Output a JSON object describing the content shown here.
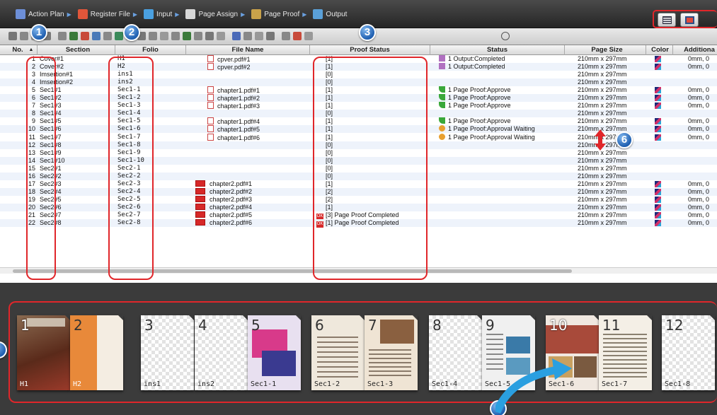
{
  "workflow": {
    "steps": [
      {
        "label": "Action Plan",
        "icon": "action-plan-icon"
      },
      {
        "label": "Register File",
        "icon": "register-file-icon"
      },
      {
        "label": "Input",
        "icon": "input-icon"
      },
      {
        "label": "Page Assign",
        "icon": "page-assign-icon"
      },
      {
        "label": "Page Proof",
        "icon": "page-proof-icon"
      },
      {
        "label": "Output",
        "icon": "output-icon"
      }
    ]
  },
  "view_buttons": [
    {
      "icon": "list-view-icon"
    },
    {
      "icon": "thumbnail-view-icon"
    }
  ],
  "table": {
    "columns": [
      "No.",
      "Section",
      "Folio",
      "File Name",
      "Proof Status",
      "Status",
      "Page Size",
      "Color",
      "Additiona"
    ],
    "sort_indicator": "▲",
    "rows": [
      {
        "no": "1",
        "section": "Cover#1",
        "folio": "H1",
        "file": "cpver.pdf#1",
        "file_icon": "pdf",
        "proof": "[1]",
        "proof_ok": false,
        "status": "1 Output:Completed",
        "status_icon": "output",
        "size": "210mm x 297mm",
        "color": true,
        "additional": "0mm, 0"
      },
      {
        "no": "2",
        "section": "Cover#2",
        "folio": "H2",
        "file": "cpver.pdf#2",
        "file_icon": "pdf",
        "proof": "[1]",
        "proof_ok": false,
        "status": "1 Output:Completed",
        "status_icon": "output",
        "size": "210mm x 297mm",
        "color": true,
        "additional": "0mm, 0"
      },
      {
        "no": "3",
        "section": "Imsertion#1",
        "folio": "ins1",
        "file": "",
        "file_icon": "",
        "proof": "[0]",
        "proof_ok": false,
        "status": "",
        "status_icon": "",
        "size": "210mm x 297mm",
        "color": false,
        "additional": ""
      },
      {
        "no": "4",
        "section": "Imsertion#2",
        "folio": "ins2",
        "file": "",
        "file_icon": "",
        "proof": "[0]",
        "proof_ok": false,
        "status": "",
        "status_icon": "",
        "size": "210mm x 297mm",
        "color": false,
        "additional": ""
      },
      {
        "no": "5",
        "section": "Sec1#1",
        "folio": "Sec1-1",
        "file": "chapter1.pdf#1",
        "file_icon": "pdf",
        "proof": "[1]",
        "proof_ok": false,
        "status": "1 Page Proof:Approve",
        "status_icon": "approve",
        "size": "210mm x 297mm",
        "color": true,
        "additional": "0mm, 0"
      },
      {
        "no": "6",
        "section": "Sec1#2",
        "folio": "Sec1-2",
        "file": "chapter1.pdf#2",
        "file_icon": "pdf",
        "proof": "[1]",
        "proof_ok": false,
        "status": "1 Page Proof:Approve",
        "status_icon": "approve",
        "size": "210mm x 297mm",
        "color": true,
        "additional": "0mm, 0"
      },
      {
        "no": "7",
        "section": "Sec1#3",
        "folio": "Sec1-3",
        "file": "chapter1.pdf#3",
        "file_icon": "pdf",
        "proof": "[1]",
        "proof_ok": false,
        "status": "1 Page Proof:Approve",
        "status_icon": "approve",
        "size": "210mm x 297mm",
        "color": true,
        "additional": "0mm, 0"
      },
      {
        "no": "8",
        "section": "Sec1#4",
        "folio": "Sec1-4",
        "file": "",
        "file_icon": "",
        "proof": "[0]",
        "proof_ok": false,
        "status": "",
        "status_icon": "",
        "size": "210mm x 297mm",
        "color": false,
        "additional": ""
      },
      {
        "no": "9",
        "section": "Sec1#5",
        "folio": "Sec1-5",
        "file": "chapter1.pdf#4",
        "file_icon": "pdf",
        "proof": "[1]",
        "proof_ok": false,
        "status": "1 Page Proof:Approve",
        "status_icon": "approve",
        "size": "210mm x 297mm",
        "color": true,
        "additional": "0mm, 0"
      },
      {
        "no": "10",
        "section": "Sec1#6",
        "folio": "Sec1-6",
        "file": "chapter1.pdf#5",
        "file_icon": "pdf",
        "proof": "[1]",
        "proof_ok": false,
        "status": "1 Page Proof:Approval Waiting",
        "status_icon": "waiting",
        "size": "210mm x 297mm",
        "color": true,
        "additional": "0mm, 0"
      },
      {
        "no": "11",
        "section": "Sec1#7",
        "folio": "Sec1-7",
        "file": "chapter1.pdf#6",
        "file_icon": "pdf",
        "proof": "[1]",
        "proof_ok": false,
        "status": "1 Page Proof:Approval Waiting",
        "status_icon": "waiting",
        "size": "210mm x 297mm",
        "color": true,
        "additional": "0mm, 0"
      },
      {
        "no": "12",
        "section": "Sec1#8",
        "folio": "Sec1-8",
        "file": "",
        "file_icon": "",
        "proof": "[0]",
        "proof_ok": false,
        "status": "",
        "status_icon": "",
        "size": "210mm x 297mm",
        "color": false,
        "additional": ""
      },
      {
        "no": "13",
        "section": "Sec1#9",
        "folio": "Sec1-9",
        "file": "",
        "file_icon": "",
        "proof": "[0]",
        "proof_ok": false,
        "status": "",
        "status_icon": "",
        "size": "210mm x 297mm",
        "color": false,
        "additional": ""
      },
      {
        "no": "14",
        "section": "Sec1#10",
        "folio": "Sec1-10",
        "file": "",
        "file_icon": "",
        "proof": "[0]",
        "proof_ok": false,
        "status": "",
        "status_icon": "",
        "size": "210mm x 297mm",
        "color": false,
        "additional": ""
      },
      {
        "no": "15",
        "section": "Sec2#1",
        "folio": "Sec2-1",
        "file": "",
        "file_icon": "",
        "proof": "[0]",
        "proof_ok": false,
        "status": "",
        "status_icon": "",
        "size": "210mm x 297mm",
        "color": false,
        "additional": ""
      },
      {
        "no": "16",
        "section": "Sec2#2",
        "folio": "Sec2-2",
        "file": "",
        "file_icon": "",
        "proof": "[0]",
        "proof_ok": false,
        "status": "",
        "status_icon": "",
        "size": "210mm x 297mm",
        "color": false,
        "additional": ""
      },
      {
        "no": "17",
        "section": "Sec2#3",
        "folio": "Sec2-3",
        "file": "chapter2.pdf#1",
        "file_icon": "pdf-red",
        "proof": "[1]",
        "proof_ok": false,
        "status": "",
        "status_icon": "",
        "size": "210mm x 297mm",
        "color": true,
        "additional": "0mm, 0"
      },
      {
        "no": "18",
        "section": "Sec2#4",
        "folio": "Sec2-4",
        "file": "chapter2.pdf#2",
        "file_icon": "pdf-red",
        "proof": "[2]",
        "proof_ok": false,
        "status": "",
        "status_icon": "",
        "size": "210mm x 297mm",
        "color": true,
        "additional": "0mm, 0"
      },
      {
        "no": "19",
        "section": "Sec2#5",
        "folio": "Sec2-5",
        "file": "chapter2.pdf#3",
        "file_icon": "pdf-red",
        "proof": "[2]",
        "proof_ok": false,
        "status": "",
        "status_icon": "",
        "size": "210mm x 297mm",
        "color": true,
        "additional": "0mm, 0"
      },
      {
        "no": "20",
        "section": "Sec2#6",
        "folio": "Sec2-6",
        "file": "chapter2.pdf#4",
        "file_icon": "pdf-red",
        "proof": "[1]",
        "proof_ok": false,
        "status": "",
        "status_icon": "",
        "size": "210mm x 297mm",
        "color": true,
        "additional": "0mm, 0"
      },
      {
        "no": "21",
        "section": "Sec2#7",
        "folio": "Sec2-7",
        "file": "chapter2.pdf#5",
        "file_icon": "pdf-red",
        "proof": "[3] Page Proof Completed",
        "proof_ok": true,
        "status": "",
        "status_icon": "",
        "size": "210mm x 297mm",
        "color": true,
        "additional": "0mm, 0"
      },
      {
        "no": "22",
        "section": "Sec2#8",
        "folio": "Sec2-8",
        "file": "chapter2.pdf#6",
        "file_icon": "pdf-red",
        "proof": "[1] Page Proof Completed",
        "proof_ok": true,
        "status": "",
        "status_icon": "",
        "size": "210mm x 297mm",
        "color": true,
        "additional": "0mm, 0"
      }
    ]
  },
  "callouts": [
    "1",
    "2",
    "3",
    "6"
  ],
  "thumbnails": [
    {
      "pages": [
        {
          "num": "1",
          "folio": "H1",
          "art": "cover"
        },
        {
          "num": "2",
          "folio": "H2",
          "art": "orange"
        }
      ]
    },
    {
      "pages": [
        {
          "num": "3",
          "folio": "ins1",
          "art": "blank"
        }
      ]
    },
    {
      "pages": [
        {
          "num": "4",
          "folio": "ins2",
          "art": "blank"
        },
        {
          "num": "5",
          "folio": "Sec1-1",
          "art": "collage"
        }
      ]
    },
    {
      "pages": [
        {
          "num": "6",
          "folio": "Sec1-2",
          "art": "text"
        },
        {
          "num": "7",
          "folio": "Sec1-3",
          "art": "article"
        }
      ]
    },
    {
      "pages": [
        {
          "num": "8",
          "folio": "Sec1-4",
          "art": "blank"
        },
        {
          "num": "9",
          "folio": "Sec1-5",
          "art": "photos"
        }
      ]
    },
    {
      "pages": [
        {
          "num": "10",
          "folio": "Sec1-6",
          "art": "photos2"
        },
        {
          "num": "11",
          "folio": "Sec1-7",
          "art": "text2"
        }
      ]
    },
    {
      "pages": [
        {
          "num": "12",
          "folio": "Sec1-8",
          "art": "blank"
        }
      ]
    }
  ],
  "colors": {
    "highlight": "#e0262a",
    "callout": "#1f5fb0",
    "arrow": "#2a9fe0",
    "alt_row": "#eef3fb"
  }
}
